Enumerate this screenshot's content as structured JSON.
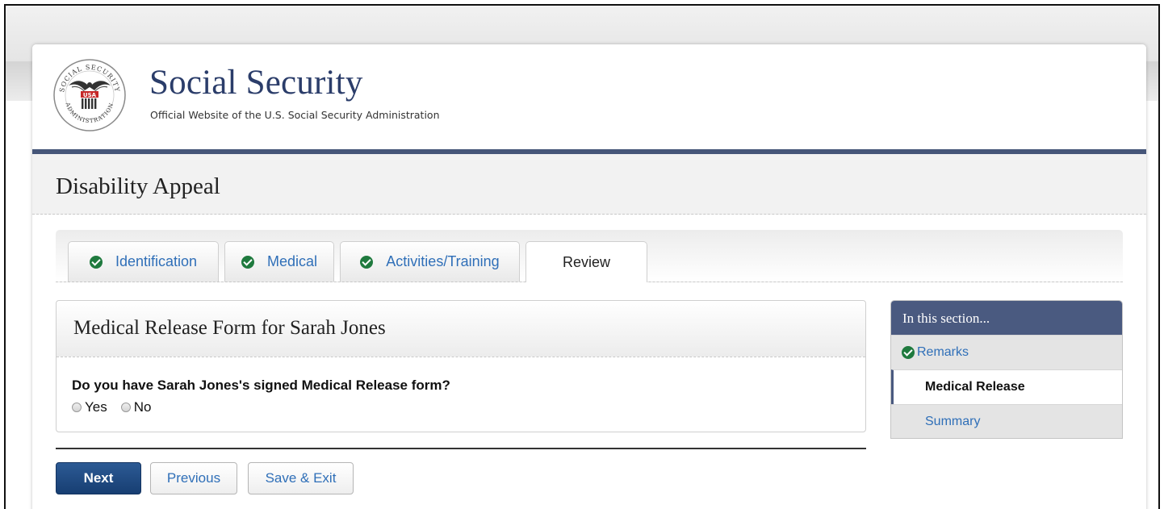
{
  "header": {
    "site_title": "Social Security",
    "site_subtitle": "Official Website of the U.S. Social Security Administration",
    "seal_lettering": "SOCIAL SECURITY ADMINISTRATION USA"
  },
  "page_title": "Disability Appeal",
  "tabs": [
    {
      "label": "Identification",
      "completed": true,
      "active": false
    },
    {
      "label": "Medical",
      "completed": true,
      "active": false
    },
    {
      "label": "Activities/Training",
      "completed": true,
      "active": false
    },
    {
      "label": "Review",
      "completed": false,
      "active": true
    }
  ],
  "form": {
    "title": "Medical Release Form for Sarah Jones",
    "question": "Do you have Sarah Jones's signed Medical Release form?",
    "options": [
      {
        "label": "Yes",
        "selected": false
      },
      {
        "label": "No",
        "selected": false
      }
    ]
  },
  "buttons": {
    "next": "Next",
    "previous": "Previous",
    "save_exit": "Save & Exit"
  },
  "sidebar": {
    "heading": "In this section...",
    "items": [
      {
        "label": "Remarks",
        "state": "completed"
      },
      {
        "label": "Medical Release",
        "state": "current"
      },
      {
        "label": "Summary",
        "state": "pending"
      }
    ]
  },
  "colors": {
    "brand_navy": "#2b3d6a",
    "header_bar": "#465679",
    "link_blue": "#2f6fb8",
    "check_green": "#1f7a3e",
    "primary_button": "#1c477e"
  }
}
